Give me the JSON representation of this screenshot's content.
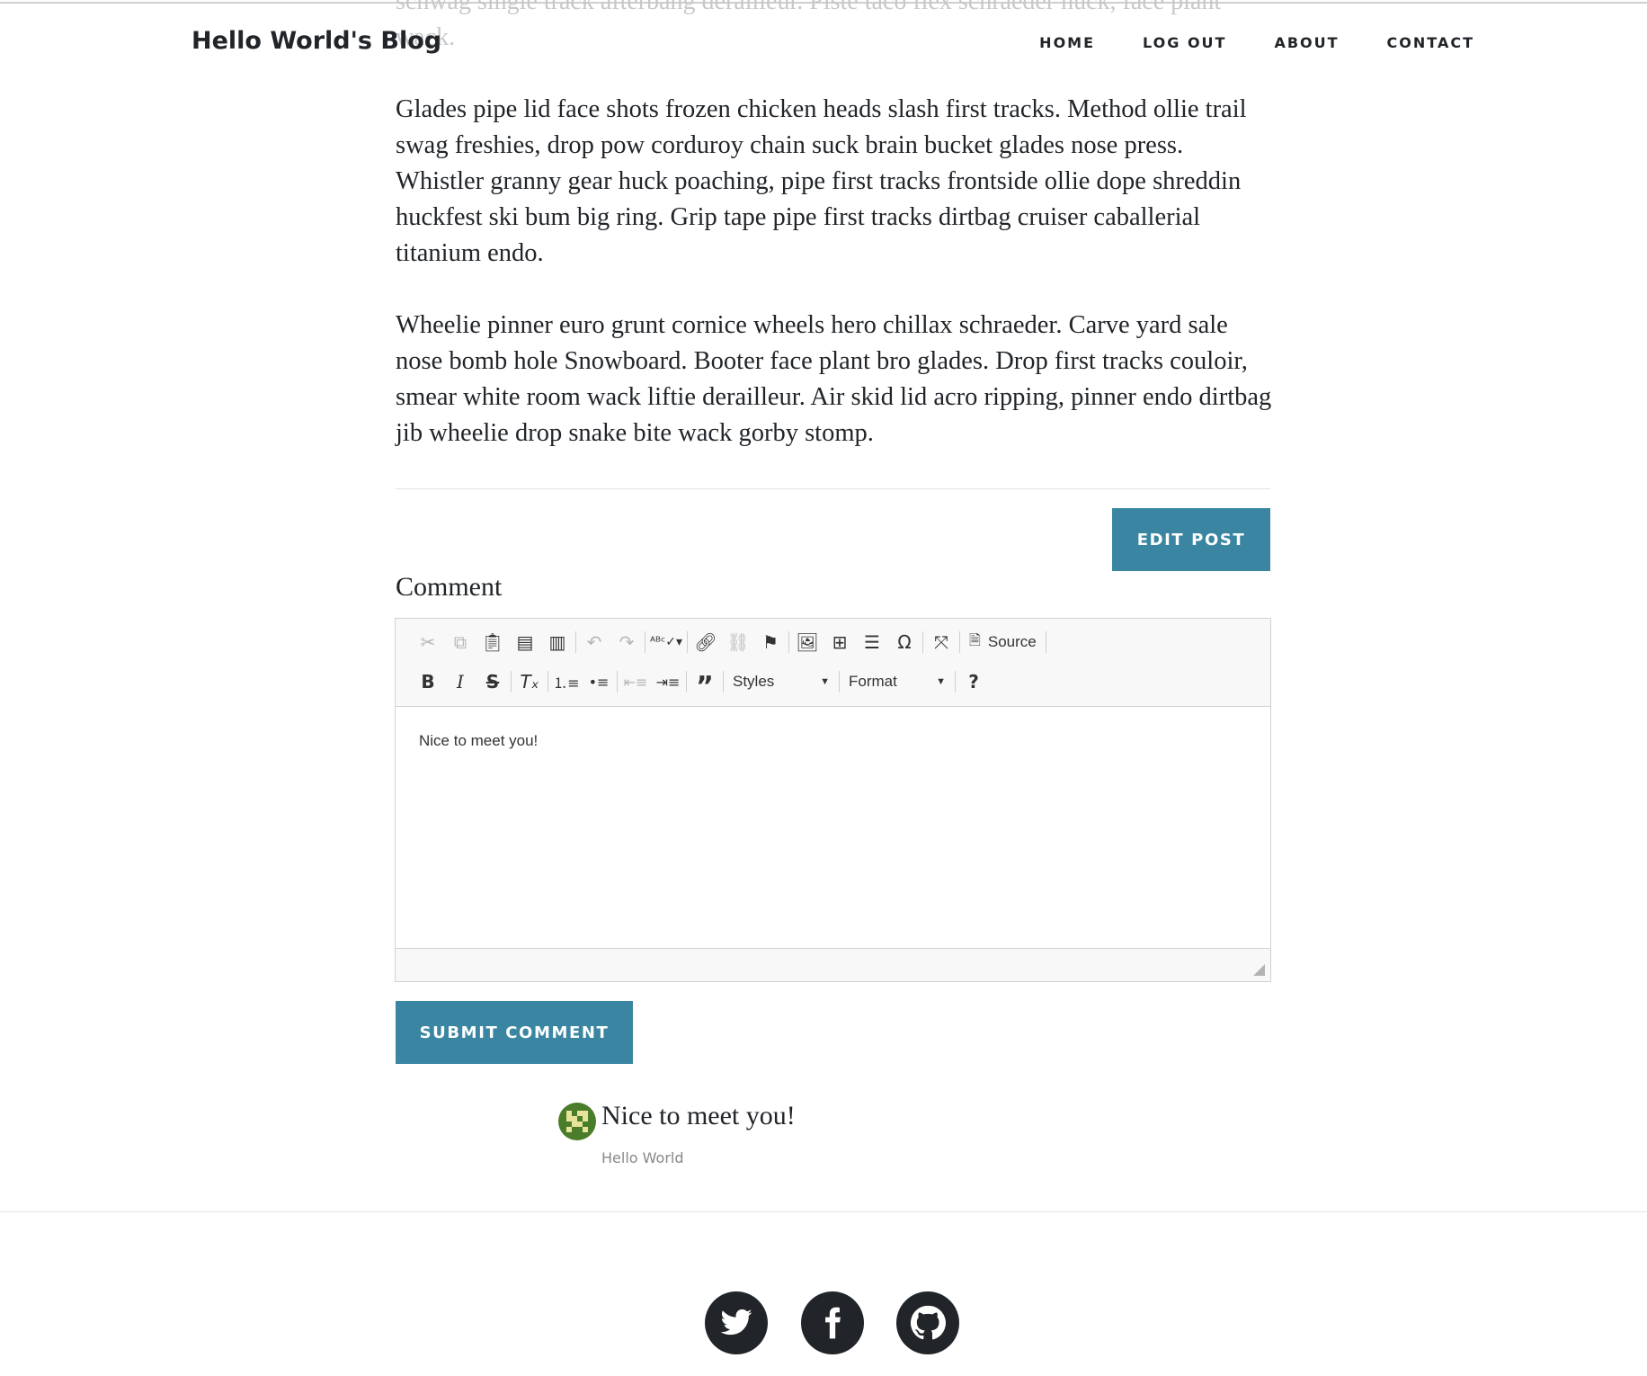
{
  "nav": {
    "brand": "Hello World's Blog",
    "links": [
      "HOME",
      "LOG OUT",
      "ABOUT",
      "CONTACT"
    ]
  },
  "article": {
    "faded_text": "schwag single track afterbang derailleur. Piste taco flex schraeder huck, face plant wack.",
    "paragraphs": [
      "Glades pipe lid face shots frozen chicken heads slash first tracks. Method ollie trail swag freshies, drop pow corduroy chain suck brain bucket glades nose press. Whistler granny gear huck poaching, pipe first tracks frontside ollie dope shreddin huckfest ski bum big ring. Grip tape pipe first tracks dirtbag cruiser caballerial titanium endo.",
      "Wheelie pinner euro grunt cornice wheels hero chillax schraeder. Carve yard sale nose bomb hole Snowboard. Booter face plant bro glades. Drop first tracks couloir, smear white room wack liftie derailleur. Air skid lid acro ripping, pinner endo dirtbag jib wheelie drop snake bite wack gorby stomp."
    ]
  },
  "edit_post_label": "EDIT POST",
  "comment_form": {
    "label": "Comment",
    "toolbar": {
      "source_label": "Source",
      "styles_label": "Styles",
      "format_label": "Format"
    },
    "content": "Nice to meet you!",
    "submit_label": "SUBMIT COMMENT"
  },
  "comments": [
    {
      "text": "Nice to meet you!",
      "author": "Hello World"
    }
  ],
  "colors": {
    "accent": "#3a86a2",
    "dark": "#212529",
    "avatar_green": "#4a7d2a",
    "avatar_yellow": "#e8e39a"
  },
  "footer": {
    "social_icons": [
      "twitter-icon",
      "facebook-icon",
      "github-icon"
    ]
  }
}
